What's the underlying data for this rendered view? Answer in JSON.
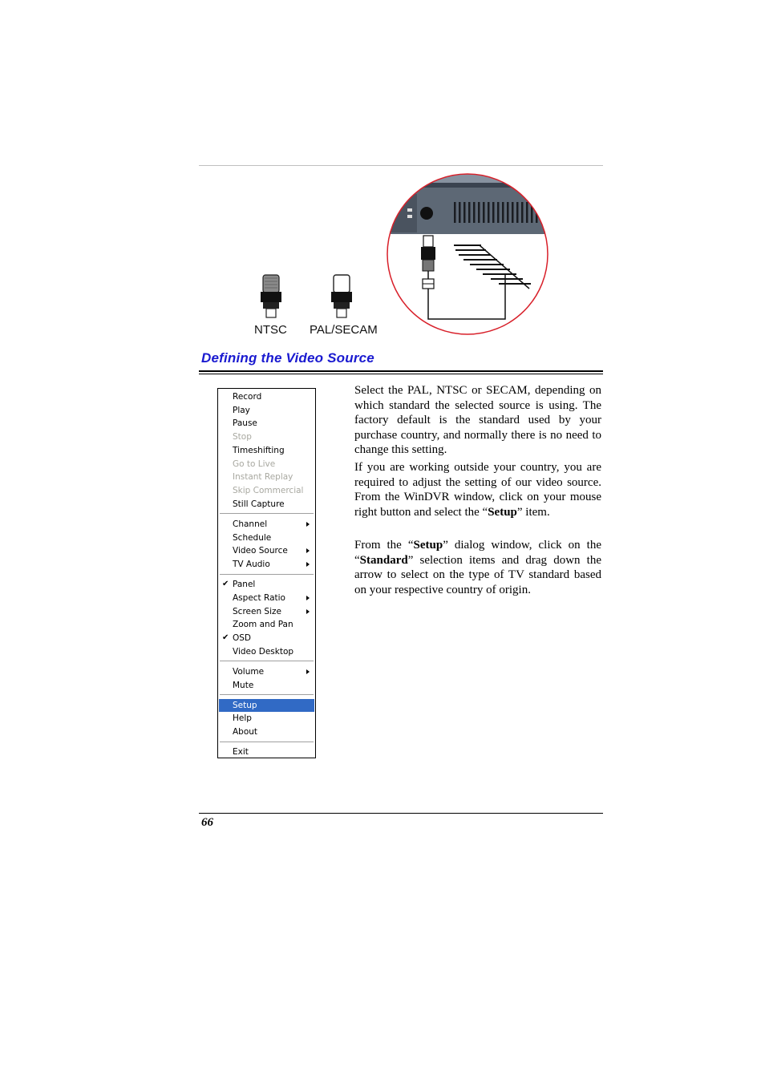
{
  "figure": {
    "connectors": [
      {
        "label": "NTSC",
        "tip_style": "gray"
      },
      {
        "label": "PAL/SECAM",
        "tip_style": "white"
      }
    ],
    "hookup_icon": "antenna-to-tv-tuner-connection",
    "circle_color": "#d8202a"
  },
  "section": {
    "title": "Defining the Video Source",
    "title_color": "#1a1ad0"
  },
  "context_menu": {
    "highlight_color": "#316ac5",
    "groups": [
      [
        {
          "label": "Record",
          "enabled": true
        },
        {
          "label": "Play",
          "enabled": true
        },
        {
          "label": "Pause",
          "enabled": true
        },
        {
          "label": "Stop",
          "enabled": false
        },
        {
          "label": "Timeshifting",
          "enabled": true
        },
        {
          "label": "Go to Live",
          "enabled": false
        },
        {
          "label": "Instant Replay",
          "enabled": false
        },
        {
          "label": "Skip Commercial",
          "enabled": false
        },
        {
          "label": "Still Capture",
          "enabled": true
        }
      ],
      [
        {
          "label": "Channel",
          "enabled": true,
          "submenu": true
        },
        {
          "label": "Schedule",
          "enabled": true
        },
        {
          "label": "Video Source",
          "enabled": true,
          "submenu": true
        },
        {
          "label": "TV Audio",
          "enabled": true,
          "submenu": true
        }
      ],
      [
        {
          "label": "Panel",
          "enabled": true,
          "checked": true
        },
        {
          "label": "Aspect Ratio",
          "enabled": true,
          "submenu": true
        },
        {
          "label": "Screen Size",
          "enabled": true,
          "submenu": true
        },
        {
          "label": "Zoom and Pan",
          "enabled": true
        },
        {
          "label": "OSD",
          "enabled": true,
          "checked": true
        },
        {
          "label": "Video Desktop",
          "enabled": true
        }
      ],
      [
        {
          "label": "Volume",
          "enabled": true,
          "submenu": true
        },
        {
          "label": "Mute",
          "enabled": true
        }
      ],
      [
        {
          "label": "Setup",
          "enabled": true,
          "selected": true
        },
        {
          "label": "Help",
          "enabled": true
        },
        {
          "label": "About",
          "enabled": true
        }
      ],
      [
        {
          "label": "Exit",
          "enabled": true
        }
      ]
    ]
  },
  "body": {
    "paragraphs": [
      [
        {
          "text": "Select the PAL, NTSC or SECAM, depending on which standard the selected source is using. The factory default is the standard used by your purchase country, and normally there is no need to change this setting."
        }
      ],
      [
        {
          "text": "If you are working outside your country, you are required to adjust the setting of our video source. From the WinDVR window, click on your mouse right button and select the “"
        },
        {
          "text": "Setup",
          "bold": true
        },
        {
          "text": "” item."
        }
      ],
      [
        {
          "text": "From the “"
        },
        {
          "text": "Setup",
          "bold": true
        },
        {
          "text": "” dialog window, click on the “"
        },
        {
          "text": "Standard",
          "bold": true
        },
        {
          "text": "” selection items and drag down the arrow to select on the type of TV standard based on your respective country of origin."
        }
      ]
    ]
  },
  "footer": {
    "page_number": "66"
  }
}
